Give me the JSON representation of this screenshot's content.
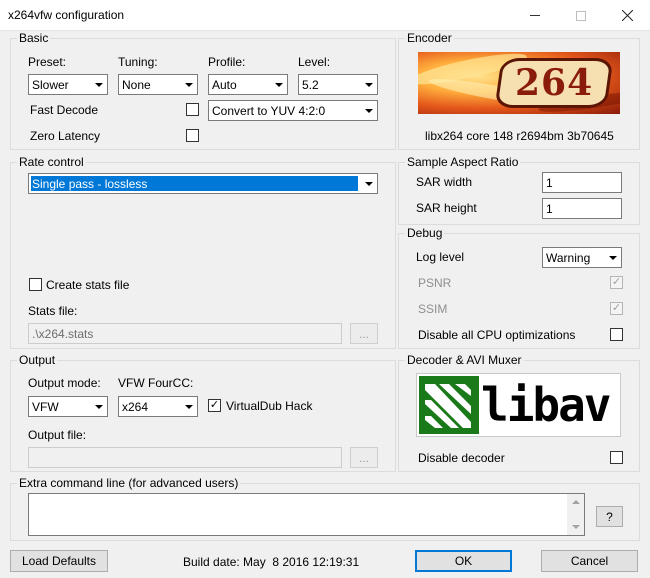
{
  "window": {
    "title": "x264vfw configuration"
  },
  "basic": {
    "legend": "Basic",
    "preset_label": "Preset:",
    "preset_value": "Slower",
    "tuning_label": "Tuning:",
    "tuning_value": "None",
    "profile_label": "Profile:",
    "profile_value": "Auto",
    "level_label": "Level:",
    "level_value": "5.2",
    "fast_decode_label": "Fast Decode",
    "fast_decode_checked": false,
    "colorspace_value": "Convert to YUV 4:2:0",
    "zero_latency_label": "Zero Latency",
    "zero_latency_checked": false
  },
  "encoder": {
    "legend": "Encoder",
    "logo_text": "264",
    "version": "libx264 core 148 r2694bm 3b70645"
  },
  "rate_control": {
    "legend": "Rate control",
    "mode_value": "Single pass - lossless",
    "create_stats_label": "Create stats file",
    "create_stats_checked": false,
    "stats_file_label": "Stats file:",
    "stats_file_value": ".\\x264.stats",
    "browse_label": "..."
  },
  "sar": {
    "legend": "Sample Aspect Ratio",
    "width_label": "SAR width",
    "width_value": "1",
    "height_label": "SAR height",
    "height_value": "1"
  },
  "debug": {
    "legend": "Debug",
    "log_level_label": "Log level",
    "log_level_value": "Warning",
    "psnr_label": "PSNR",
    "psnr_checked": true,
    "ssim_label": "SSIM",
    "ssim_checked": true,
    "disable_cpu_label": "Disable all CPU optimizations",
    "disable_cpu_checked": false
  },
  "output": {
    "legend": "Output",
    "mode_label": "Output mode:",
    "mode_value": "VFW",
    "fourcc_label": "VFW FourCC:",
    "fourcc_value": "x264",
    "vdub_hack_label": "VirtualDub Hack",
    "vdub_hack_checked": true,
    "file_label": "Output file:",
    "file_value": "",
    "browse_label": "..."
  },
  "decoder": {
    "legend": "Decoder & AVI Muxer",
    "logo_text": "libav",
    "disable_decoder_label": "Disable decoder",
    "disable_decoder_checked": false
  },
  "extra": {
    "legend": "Extra command line (for advanced users)",
    "value": "",
    "help_label": "?"
  },
  "footer": {
    "load_defaults_label": "Load Defaults",
    "build_date": "Build date: May  8 2016 12:19:31",
    "ok_label": "OK",
    "cancel_label": "Cancel"
  },
  "colors": {
    "selection": "#0078d7",
    "group_border": "#dcdcdc",
    "window_bg": "#f0f0f0"
  }
}
